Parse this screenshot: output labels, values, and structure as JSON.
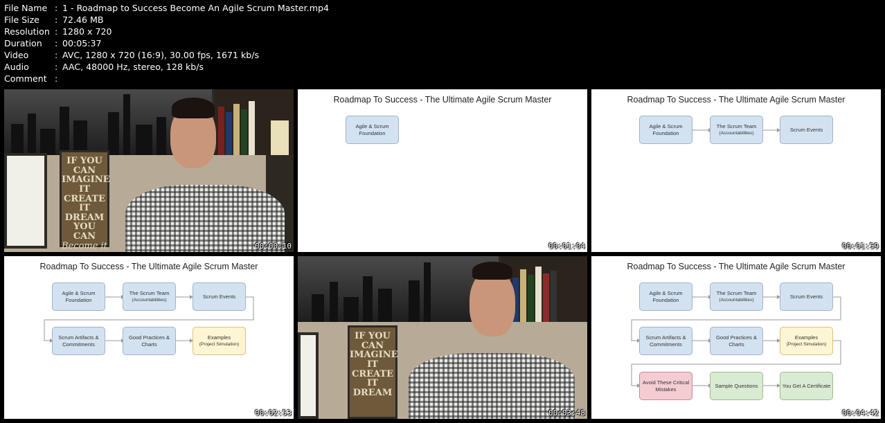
{
  "file_info": [
    {
      "key": "File Name",
      "value": "1 - Roadmap to Success Become An Agile Scrum Master.mp4"
    },
    {
      "key": "File Size",
      "value": "72.46 MB"
    },
    {
      "key": "Resolution",
      "value": "1280 x 720"
    },
    {
      "key": "Duration",
      "value": "00:05:37"
    },
    {
      "key": "Video",
      "value": "AVC, 1280 x 720 (16:9), 30.00 fps, 1671 kb/s"
    },
    {
      "key": "Audio",
      "value": "AAC, 48000 Hz, stereo, 128 kb/s"
    },
    {
      "key": "Comment",
      "value": ""
    }
  ],
  "separator": ":",
  "slide_title": "Roadmap To Success - The Ultimate Agile Scrum Master",
  "boxes": {
    "foundation": "Agile & Scrum Foundation",
    "team": "The Scrum Team",
    "team_sub": "(Accountabilities)",
    "events": "Scrum Events",
    "artifacts": "Scrum Artifacts & Commitments",
    "practices": "Good Practices & Charts",
    "examples": "Examples",
    "examples_sub": "(Project Simulation)",
    "mistakes": "Avoid These Critical Mistakes",
    "questions": "Sample Questions",
    "certificate": "You Get A Certificate"
  },
  "thumbnails": [
    {
      "timestamp": "00:00:10",
      "kind": "video"
    },
    {
      "timestamp": "00:01:04",
      "kind": "slide"
    },
    {
      "timestamp": "00:01:59",
      "kind": "slide"
    },
    {
      "timestamp": "00:02:53",
      "kind": "slide"
    },
    {
      "timestamp": "00:03:48",
      "kind": "video"
    },
    {
      "timestamp": "00:04:42",
      "kind": "slide"
    }
  ],
  "poster_text": [
    "IF YOU CAN",
    "IMAGINE IT",
    "CREATE IT",
    "DREAM",
    "YOU CAN",
    "Become it"
  ],
  "colors": {
    "box_blue": "#d3e2f1",
    "box_yellow": "#fdf5d3",
    "box_red": "#f4cdd2",
    "box_green": "#d9ebd3",
    "background": "#000000",
    "text": "#ffffff"
  }
}
